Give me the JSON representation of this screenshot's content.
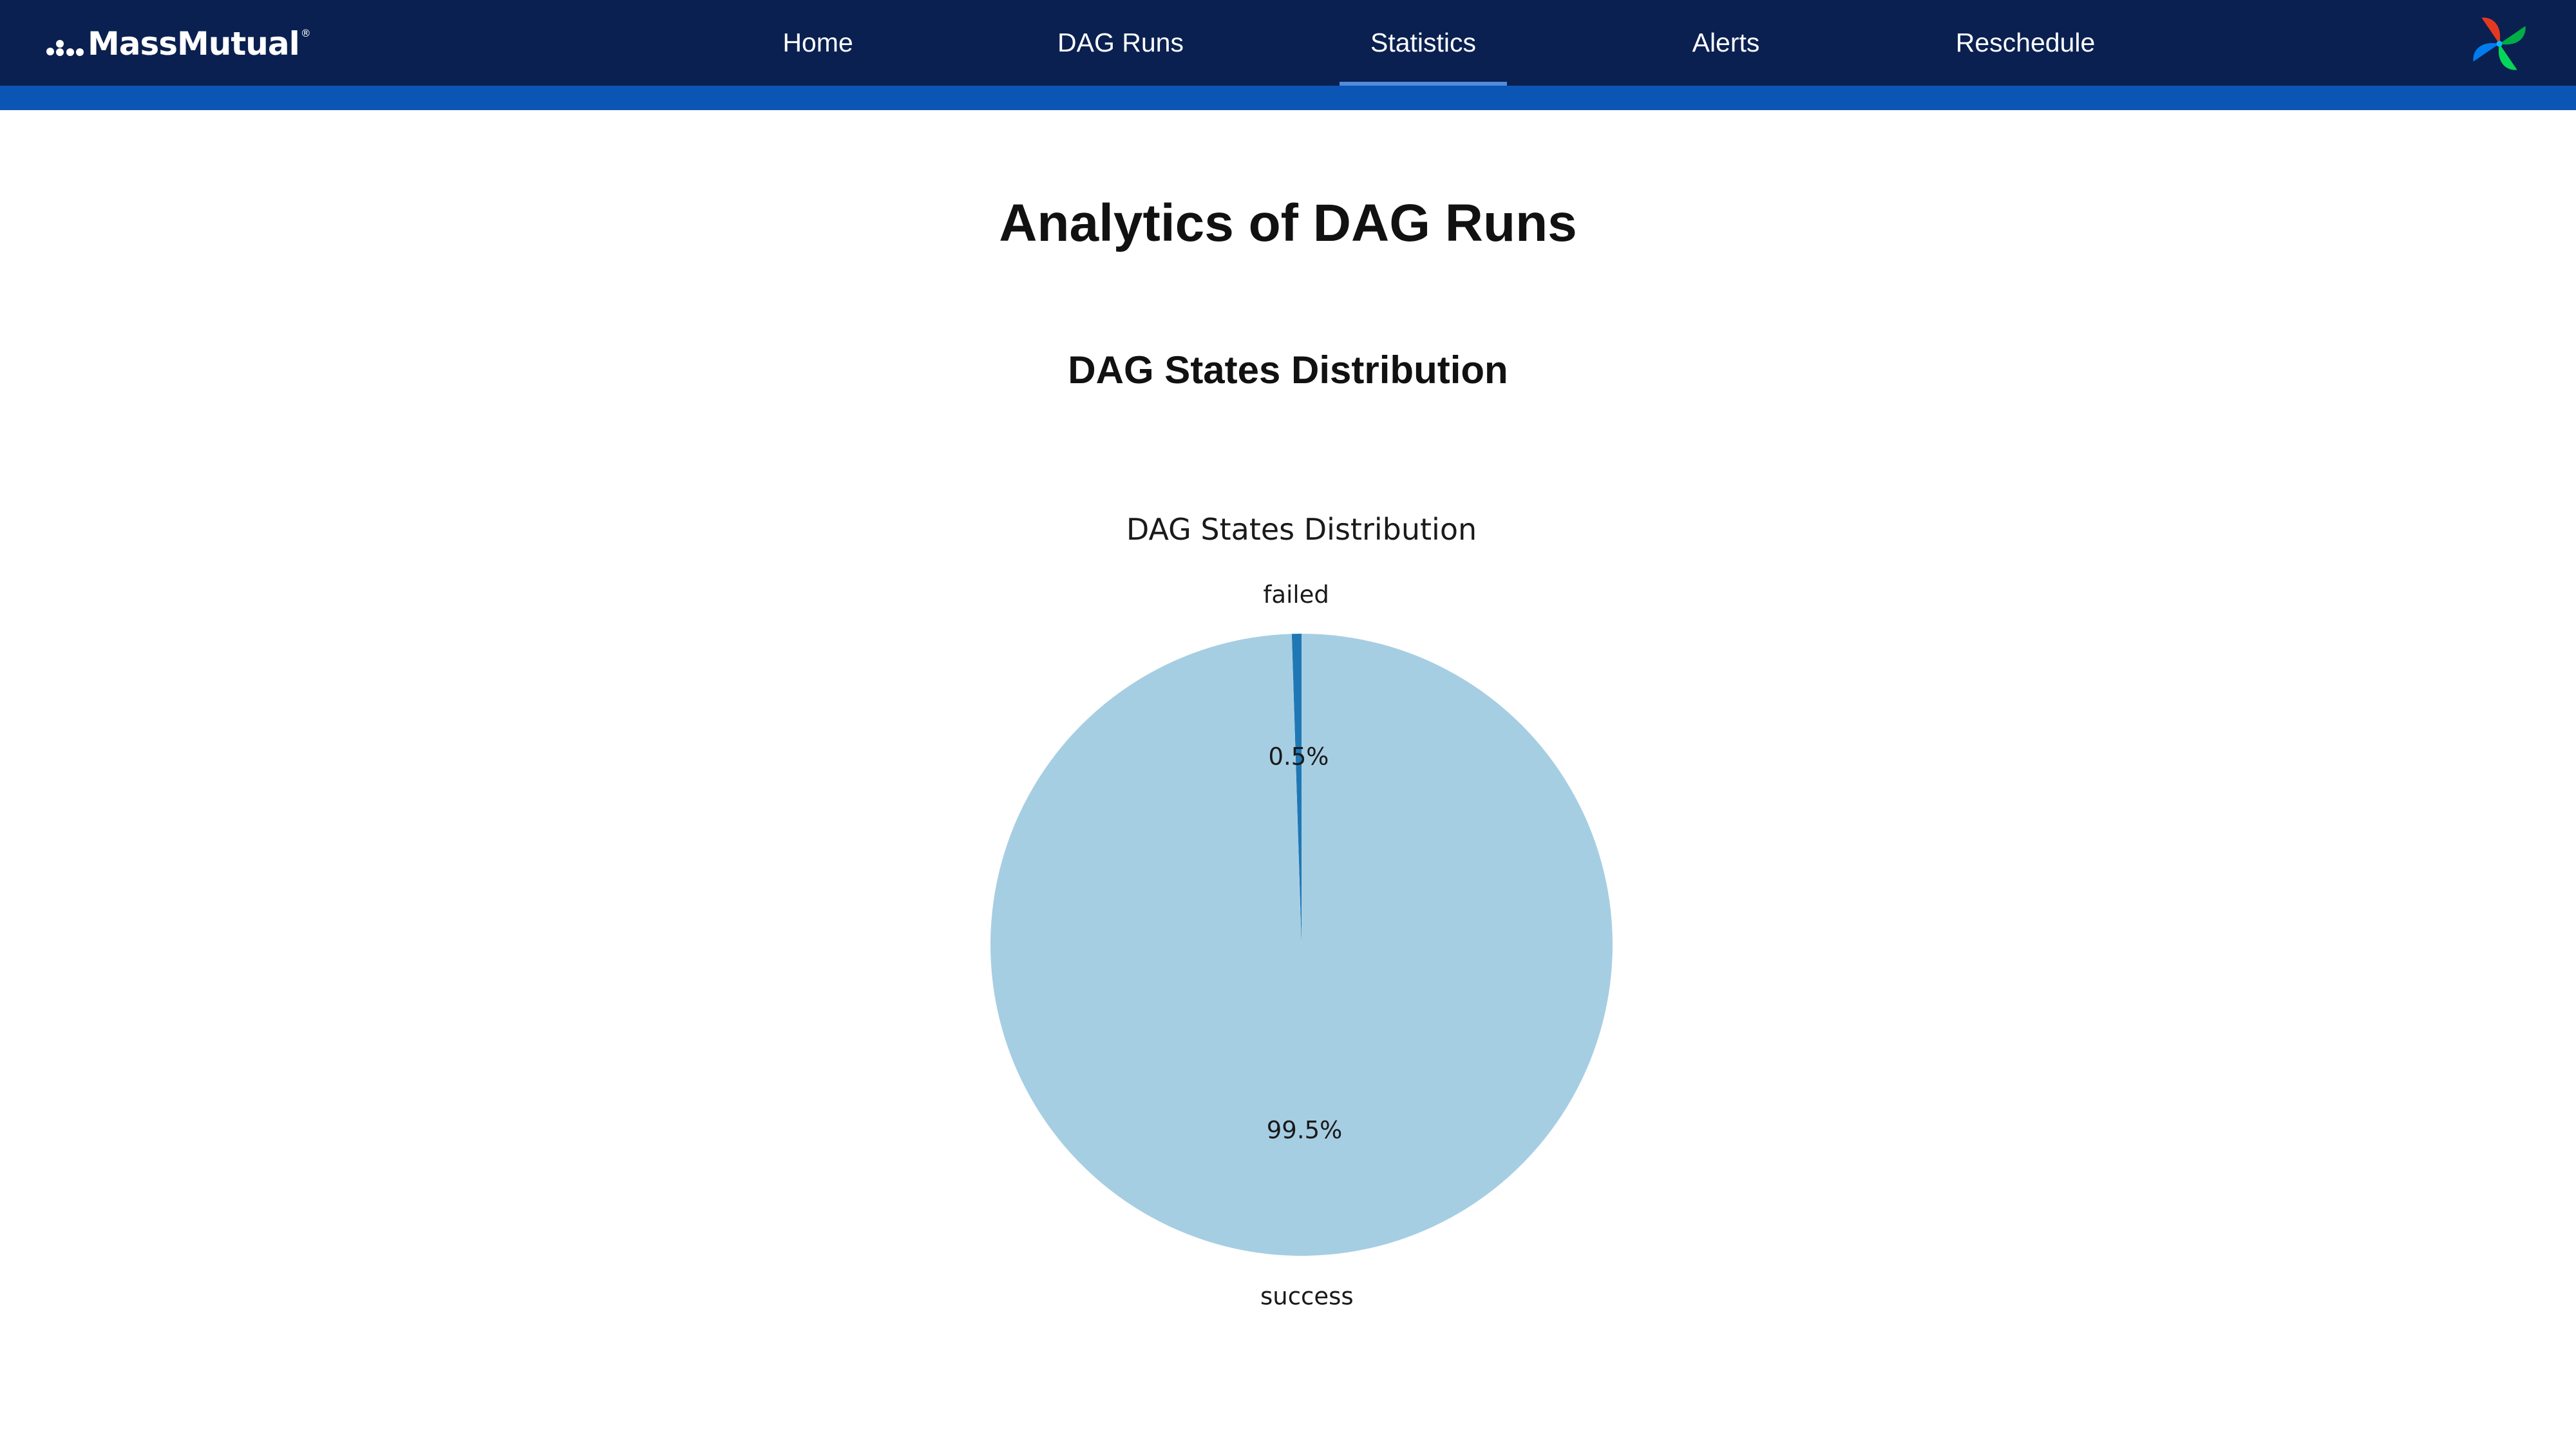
{
  "app": {
    "brand": "MassMutual",
    "brand_mark": "®"
  },
  "nav": {
    "items": [
      {
        "label": "Home",
        "active": false
      },
      {
        "label": "DAG Runs",
        "active": false
      },
      {
        "label": "Statistics",
        "active": true
      },
      {
        "label": "Alerts",
        "active": false
      },
      {
        "label": "Reschedule",
        "active": false
      }
    ],
    "right_icon": "airflow-pinwheel-icon"
  },
  "colors": {
    "navbar": "#0a2050",
    "stripe": "#0b55b5",
    "active_underline": "#4f8ddc"
  },
  "main": {
    "title": "Analytics of DAG Runs",
    "section_title": "DAG States Distribution"
  },
  "chart_data": {
    "type": "pie",
    "title": "DAG States Distribution",
    "categories": [
      "failed",
      "success"
    ],
    "values": [
      0.5,
      99.5
    ],
    "value_labels": [
      "0.5%",
      "99.5%"
    ],
    "colors": [
      "#1f78b4",
      "#a6cee3"
    ],
    "start_angle_deg": 90,
    "direction": "counterclockwise"
  }
}
